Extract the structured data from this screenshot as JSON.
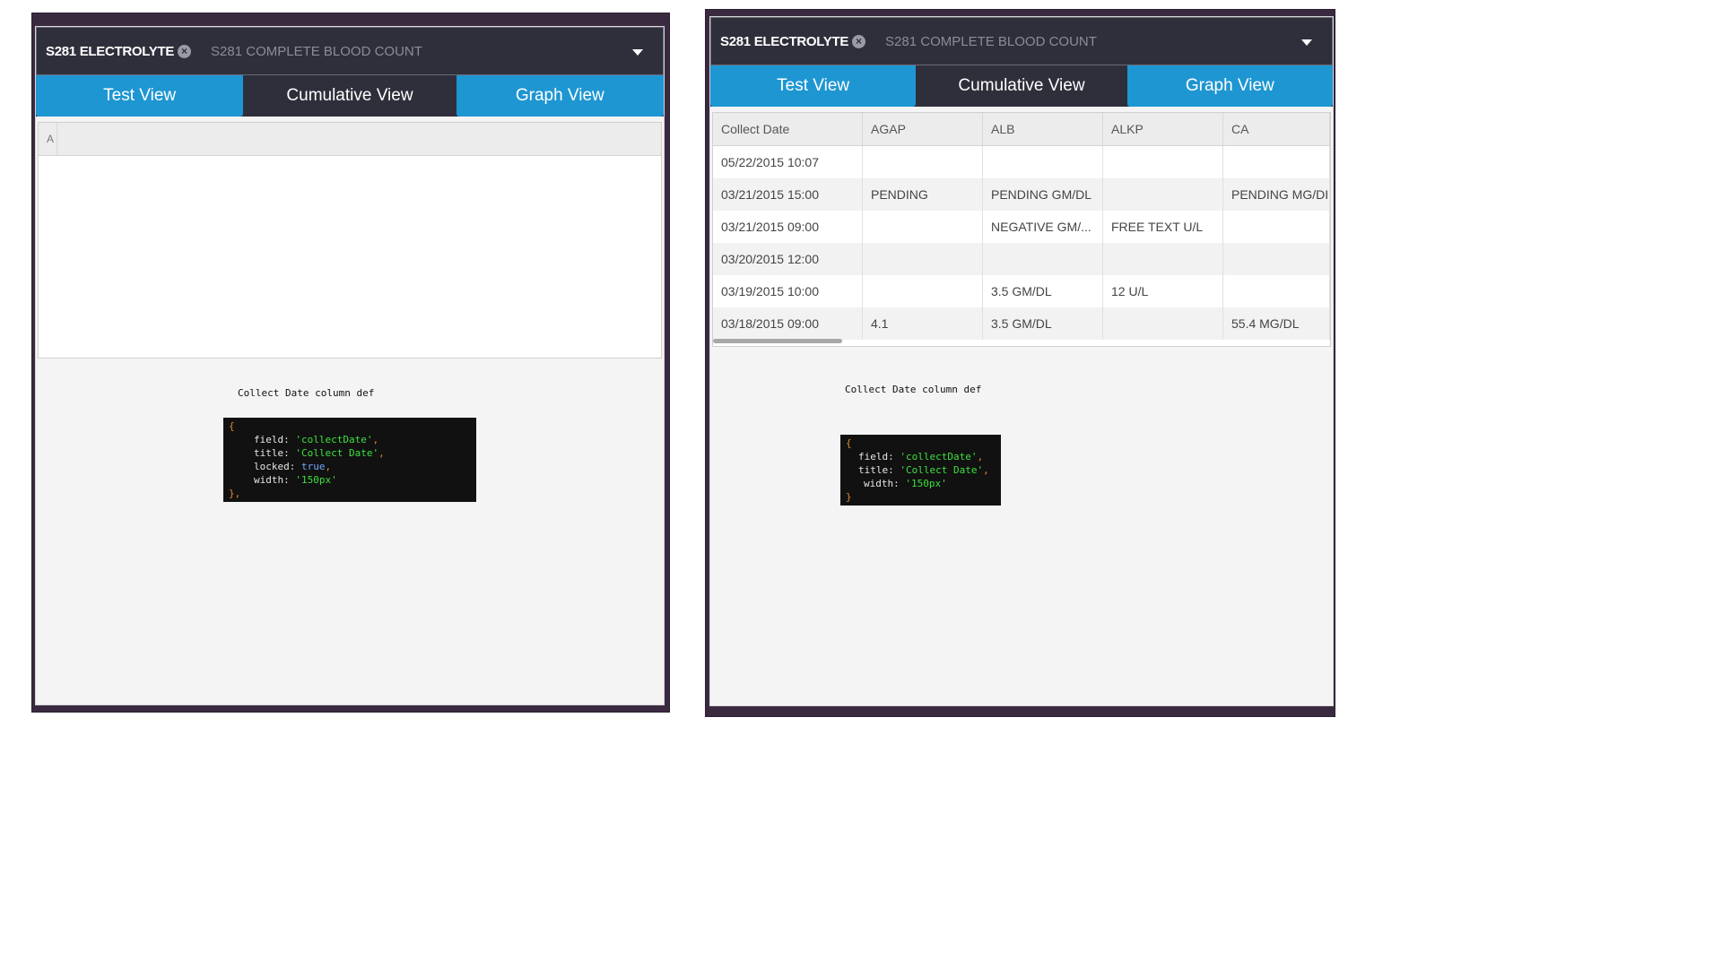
{
  "panels": [
    {
      "header": {
        "active_tab": "S281 ELECTROLYTE",
        "inactive_tab": "S281 COMPLETE BLOOD COUNT",
        "close_glyph": "×"
      },
      "views": [
        "Test View",
        "Cumulative View",
        "Graph View"
      ],
      "grid_partial_header": "A",
      "caption": "Collect Date column def",
      "code_lines": [
        {
          "key": "field",
          "value": "'collectDate'",
          "type": "string"
        },
        {
          "key": "title",
          "value": "'Collect Date'",
          "type": "string"
        },
        {
          "key": "locked",
          "value": "true",
          "type": "bool"
        },
        {
          "key": "width",
          "value": "'150px'",
          "type": "string"
        }
      ]
    },
    {
      "header": {
        "active_tab": "S281 ELECTROLYTE",
        "inactive_tab": "S281 COMPLETE BLOOD COUNT",
        "close_glyph": "×"
      },
      "views": [
        "Test View",
        "Cumulative View",
        "Graph View"
      ],
      "table": {
        "columns": [
          "Collect Date",
          "AGAP",
          "ALB",
          "ALKP",
          "CA"
        ],
        "rows": [
          [
            "05/22/2015 10:07",
            "",
            "",
            "",
            ""
          ],
          [
            "03/21/2015 15:00",
            "PENDING",
            "PENDING GM/DL",
            "",
            "PENDING MG/DI"
          ],
          [
            "03/21/2015 09:00",
            "",
            "NEGATIVE GM/...",
            "FREE TEXT U/L",
            ""
          ],
          [
            "03/20/2015 12:00",
            "",
            "",
            "",
            ""
          ],
          [
            "03/19/2015 10:00",
            "",
            "3.5 GM/DL",
            "12 U/L",
            ""
          ],
          [
            "03/18/2015 09:00",
            "4.1",
            "3.5 GM/DL",
            "",
            "55.4 MG/DL"
          ]
        ]
      },
      "caption": "Collect Date column def",
      "code_lines": [
        {
          "key": "field",
          "value": "'collectDate'",
          "type": "string"
        },
        {
          "key": "title",
          "value": "'Collect Date'",
          "type": "string"
        },
        {
          "key": "width",
          "value": "'150px'",
          "type": "string"
        }
      ]
    }
  ],
  "code_open": "{",
  "code_close_1": "},",
  "code_close_2": "}",
  "colors": {
    "header_bg": "#2f2f3c",
    "view_button_blue": "#1e96d2",
    "frame": "#3a2a40",
    "code_string": "#3ee03e",
    "code_bool": "#6fa8ff"
  }
}
